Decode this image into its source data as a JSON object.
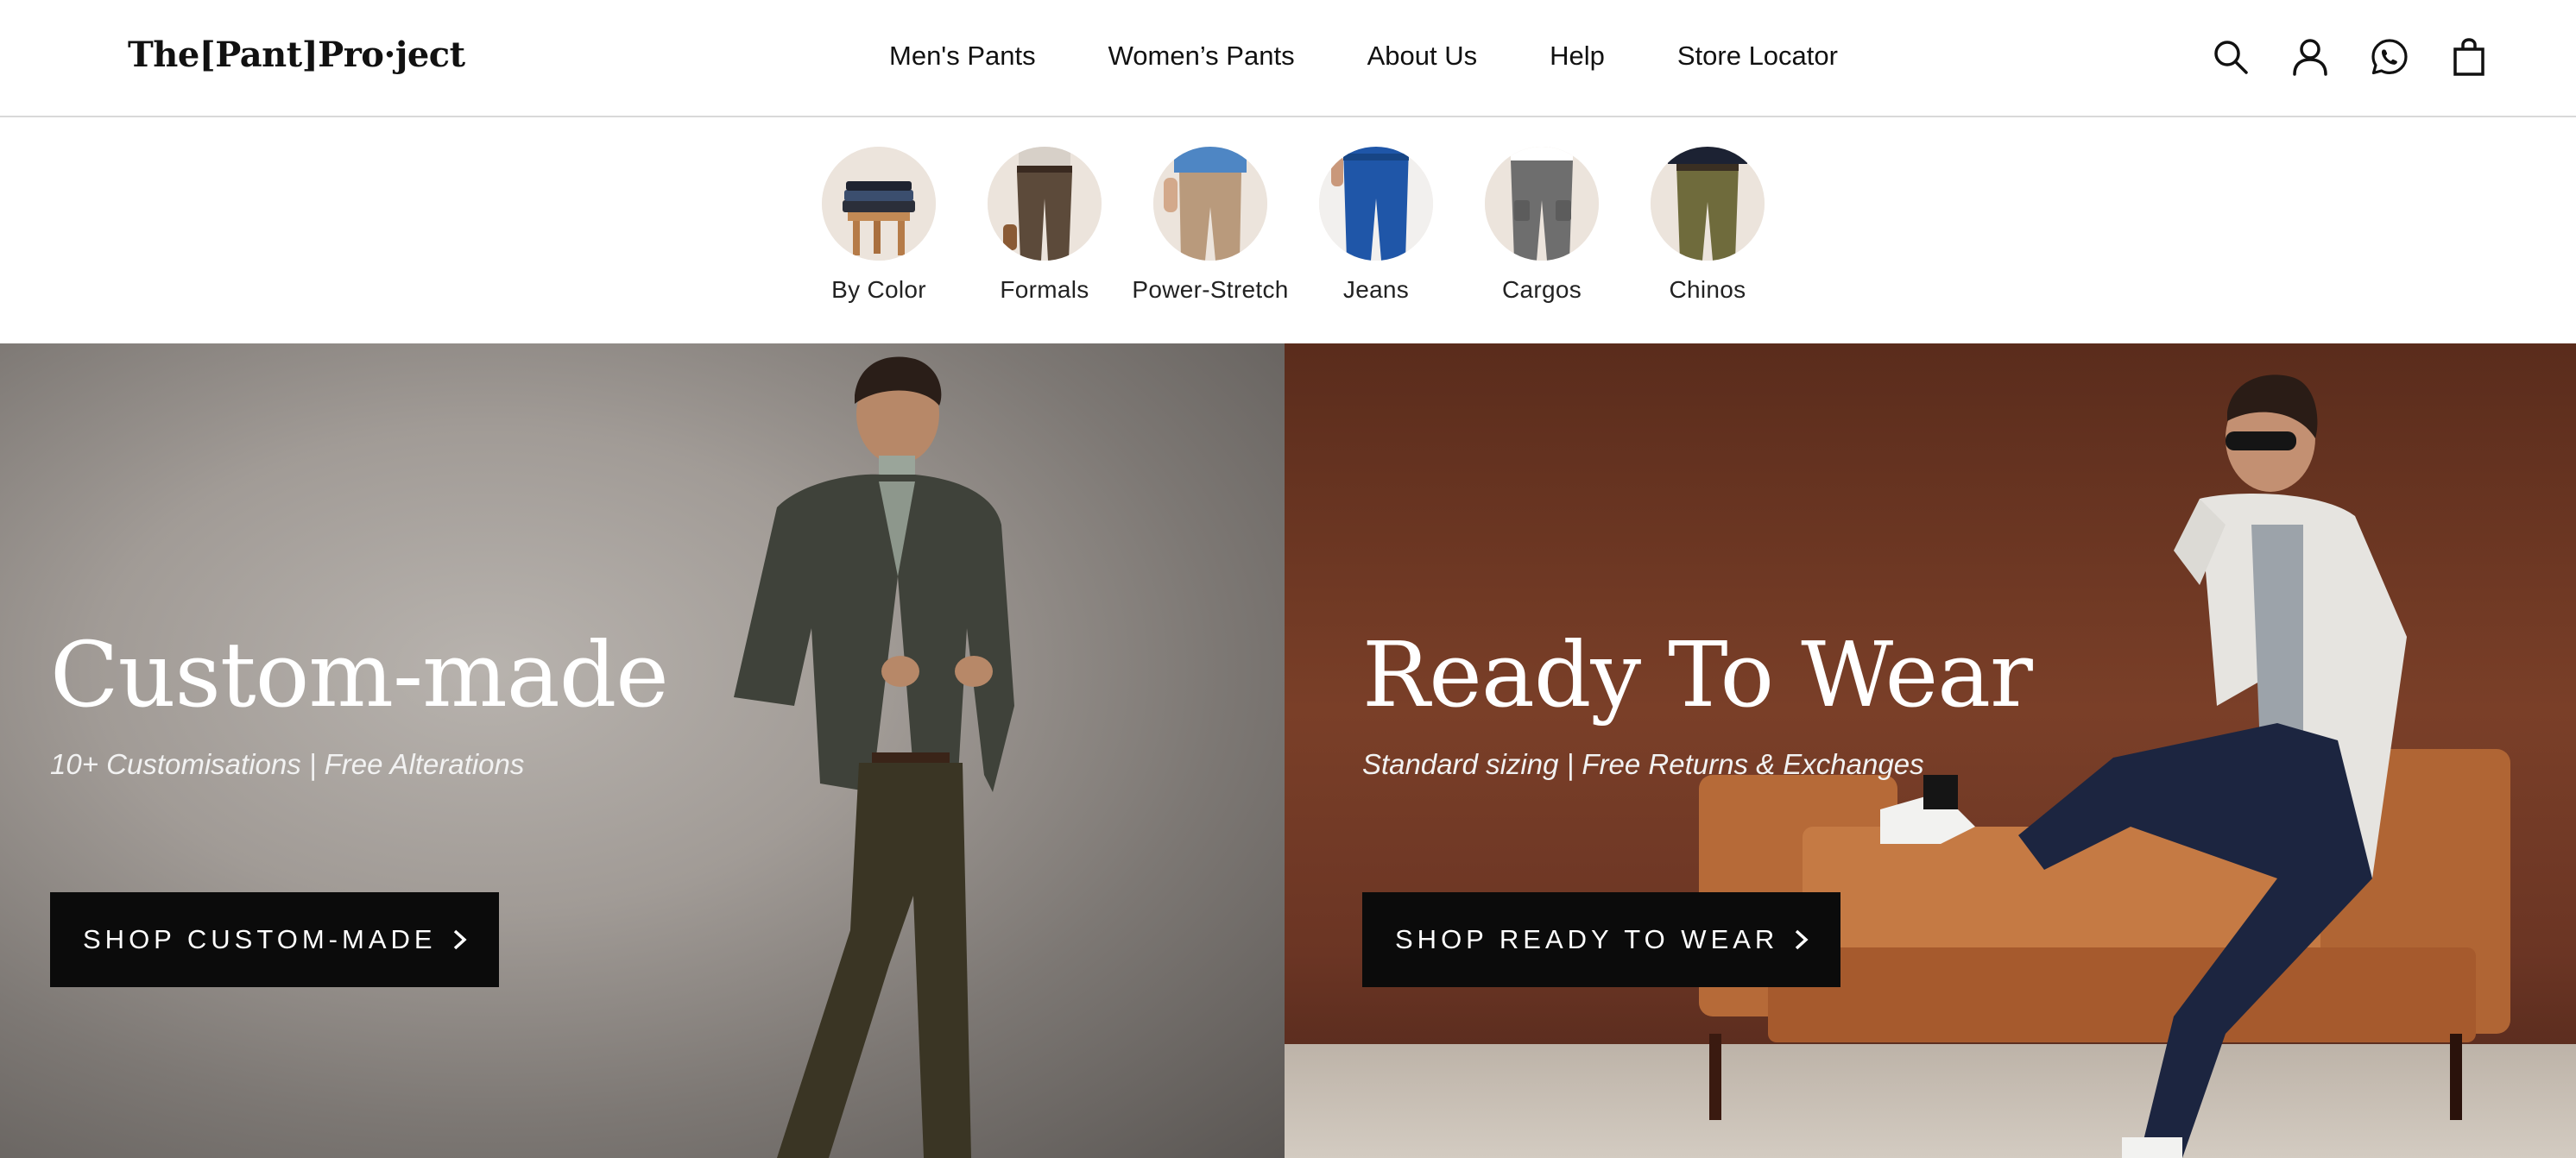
{
  "header": {
    "logo": "The[Pant]Pro·ject",
    "nav": [
      {
        "label": "Men's Pants"
      },
      {
        "label": "Women’s Pants"
      },
      {
        "label": "About Us"
      },
      {
        "label": "Help"
      },
      {
        "label": "Store Locator"
      }
    ],
    "icons": [
      "search-icon",
      "account-icon",
      "whatsapp-icon",
      "shopping-bag-icon"
    ]
  },
  "categories": [
    {
      "label": "By Color"
    },
    {
      "label": "Formals"
    },
    {
      "label": "Power-Stretch"
    },
    {
      "label": "Jeans"
    },
    {
      "label": "Cargos"
    },
    {
      "label": "Chinos"
    }
  ],
  "hero": {
    "left": {
      "title": "Custom-made",
      "subtitle": "10+ Customisations | Free Alterations",
      "button": "SHOP CUSTOM-MADE"
    },
    "right": {
      "title": "Ready To Wear",
      "subtitle": "Standard sizing  |  Free Returns & Exchanges",
      "button": "SHOP READY TO WEAR"
    }
  },
  "colors": {
    "text": "#111111",
    "button_bg": "#0b0b0b",
    "left_panel": "#a19b96",
    "right_panel": "#7a3f28"
  }
}
